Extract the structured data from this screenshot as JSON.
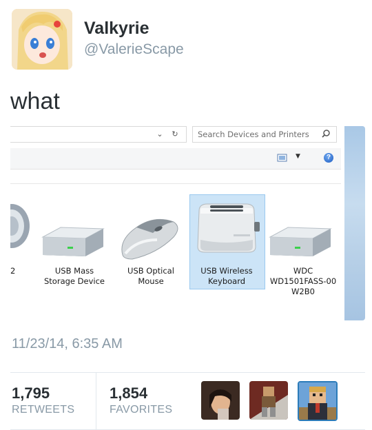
{
  "tweet": {
    "display_name": "Valkyrie",
    "handle": "@ValerieScape",
    "text": "what",
    "timestamp": "11/23/14, 6:35 AM",
    "retweets": {
      "count": "1,795",
      "label": "RETWEETS"
    },
    "favorites": {
      "count": "1,854",
      "label": "FAVORITES"
    }
  },
  "screenshot": {
    "search_placeholder": "Search Devices and Printers",
    "partial_label": "2",
    "devices": [
      {
        "line1": "USB Mass",
        "line2": "Storage Device",
        "line3": ""
      },
      {
        "line1": "USB Optical",
        "line2": "Mouse",
        "line3": ""
      },
      {
        "line1": "USB Wireless",
        "line2": "Keyboard",
        "line3": ""
      },
      {
        "line1": "WDC",
        "line2": "WD1501FASS-00",
        "line3": "W2B0"
      }
    ]
  },
  "icons": {
    "avatar": "anime-avatar",
    "search": "search-icon",
    "refresh": "refresh-icon",
    "dropdown": "chevron-down-icon",
    "help": "help-icon"
  }
}
